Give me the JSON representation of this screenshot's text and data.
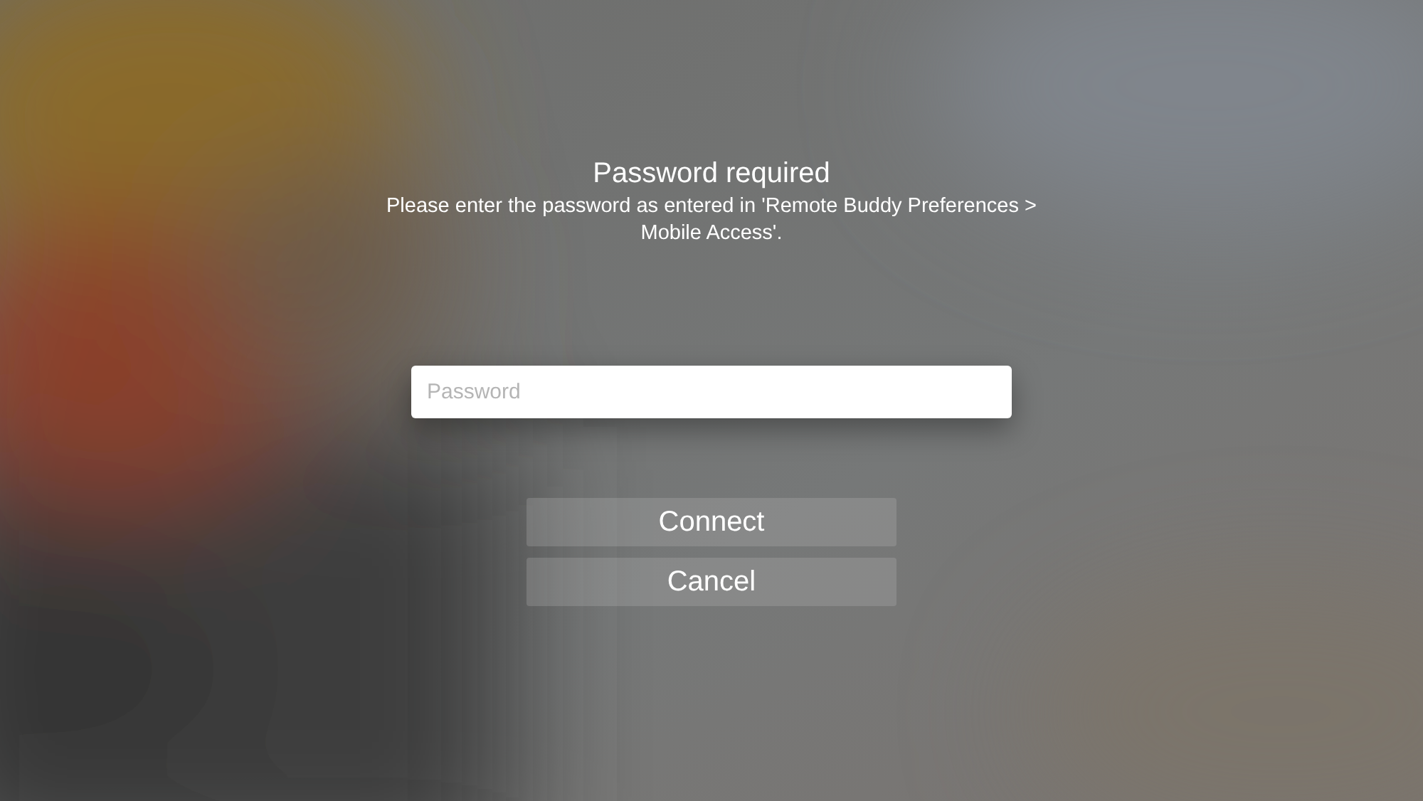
{
  "dialog": {
    "title": "Password required",
    "message": "Please enter the password as entered in 'Remote Buddy Preferences > Mobile Access'.",
    "password_field": {
      "placeholder": "Password"
    },
    "buttons": [
      {
        "label": "Connect"
      },
      {
        "label": "Cancel"
      }
    ]
  }
}
